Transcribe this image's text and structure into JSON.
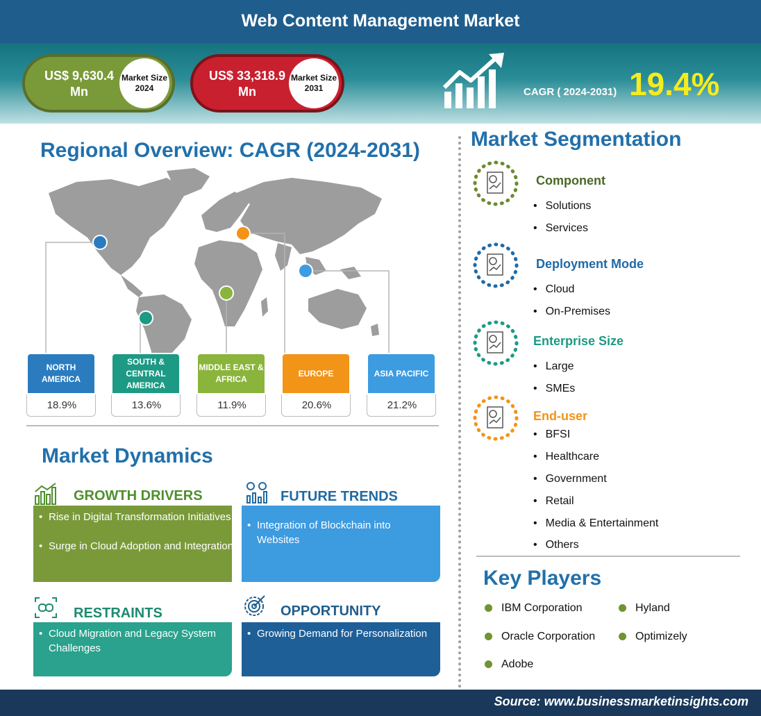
{
  "header": {
    "title": "Web Content Management Market"
  },
  "market_size": {
    "y2024": {
      "value": "US$ 9,630.4 Mn",
      "label": "Market Size 2024"
    },
    "y2031": {
      "value": "US$ 33,318.9 Mn",
      "label": "Market Size 2031"
    }
  },
  "cagr": {
    "label": "CAGR ( 2024-2031)",
    "value": "19.4%"
  },
  "regional": {
    "title": "Regional Overview: CAGR (2024-2031)",
    "regions": [
      {
        "name": "NORTH AMERICA",
        "value": "18.9%",
        "color": "#2b7cbf"
      },
      {
        "name": "SOUTH & CENTRAL AMERICA",
        "value": "13.6%",
        "color": "#1d9a84"
      },
      {
        "name": "MIDDLE EAST & AFRICA",
        "value": "11.9%",
        "color": "#8bb43c"
      },
      {
        "name": "EUROPE",
        "value": "20.6%",
        "color": "#f29418"
      },
      {
        "name": "ASIA PACIFIC",
        "value": "21.2%",
        "color": "#3d9be0"
      }
    ]
  },
  "dynamics": {
    "title": "Market Dynamics",
    "growth_drivers": {
      "title": "GROWTH DRIVERS",
      "items": [
        "Rise in Digital Transformation Initiatives",
        "Surge in Cloud Adoption and Integration"
      ]
    },
    "future_trends": {
      "title": "FUTURE TRENDS",
      "items": [
        "Integration of Blockchain into Websites"
      ]
    },
    "restraints": {
      "title": "RESTRAINTS",
      "items": [
        "Cloud Migration and Legacy System Challenges"
      ]
    },
    "opportunity": {
      "title": "OPPORTUNITY",
      "items": [
        "Growing Demand for Personalization"
      ]
    }
  },
  "segmentation": {
    "title": "Market Segmentation",
    "segments": [
      {
        "name": "Component",
        "color": "#6a8c2e",
        "items": [
          "Solutions",
          "Services"
        ]
      },
      {
        "name": "Deployment Mode",
        "color": "#1e6aa8",
        "items": [
          "Cloud",
          "On-Premises"
        ]
      },
      {
        "name": "Enterprise Size",
        "color": "#1d9a84",
        "items": [
          "Large",
          "SMEs"
        ]
      },
      {
        "name": "End-user",
        "color": "#f29418",
        "items": [
          "BFSI",
          "Healthcare",
          "Government",
          "Retail",
          "Media & Entertainment",
          "Others"
        ]
      }
    ]
  },
  "key_players": {
    "title": "Key Players",
    "players": [
      "IBM Corporation",
      "Hyland",
      "Oracle Corporation",
      "Optimizely",
      "Adobe"
    ]
  },
  "source": {
    "text": "Source: www.businessmarketinsights.com"
  },
  "colors": {
    "title_bar": "#1f5d8c",
    "section_title": "#2170ab",
    "cagr_value": "#f5ec1d",
    "growth_drivers_box": "#7a9a3a",
    "future_trends_box": "#3d9be0",
    "restraints_box": "#2aa28d",
    "opportunity_box": "#1e5f98",
    "growth_drivers_title": "#4f8f2c",
    "future_trends_title": "#1f6aa3",
    "restraints_title": "#1d8a6f",
    "opportunity_title": "#1f5d8c"
  }
}
